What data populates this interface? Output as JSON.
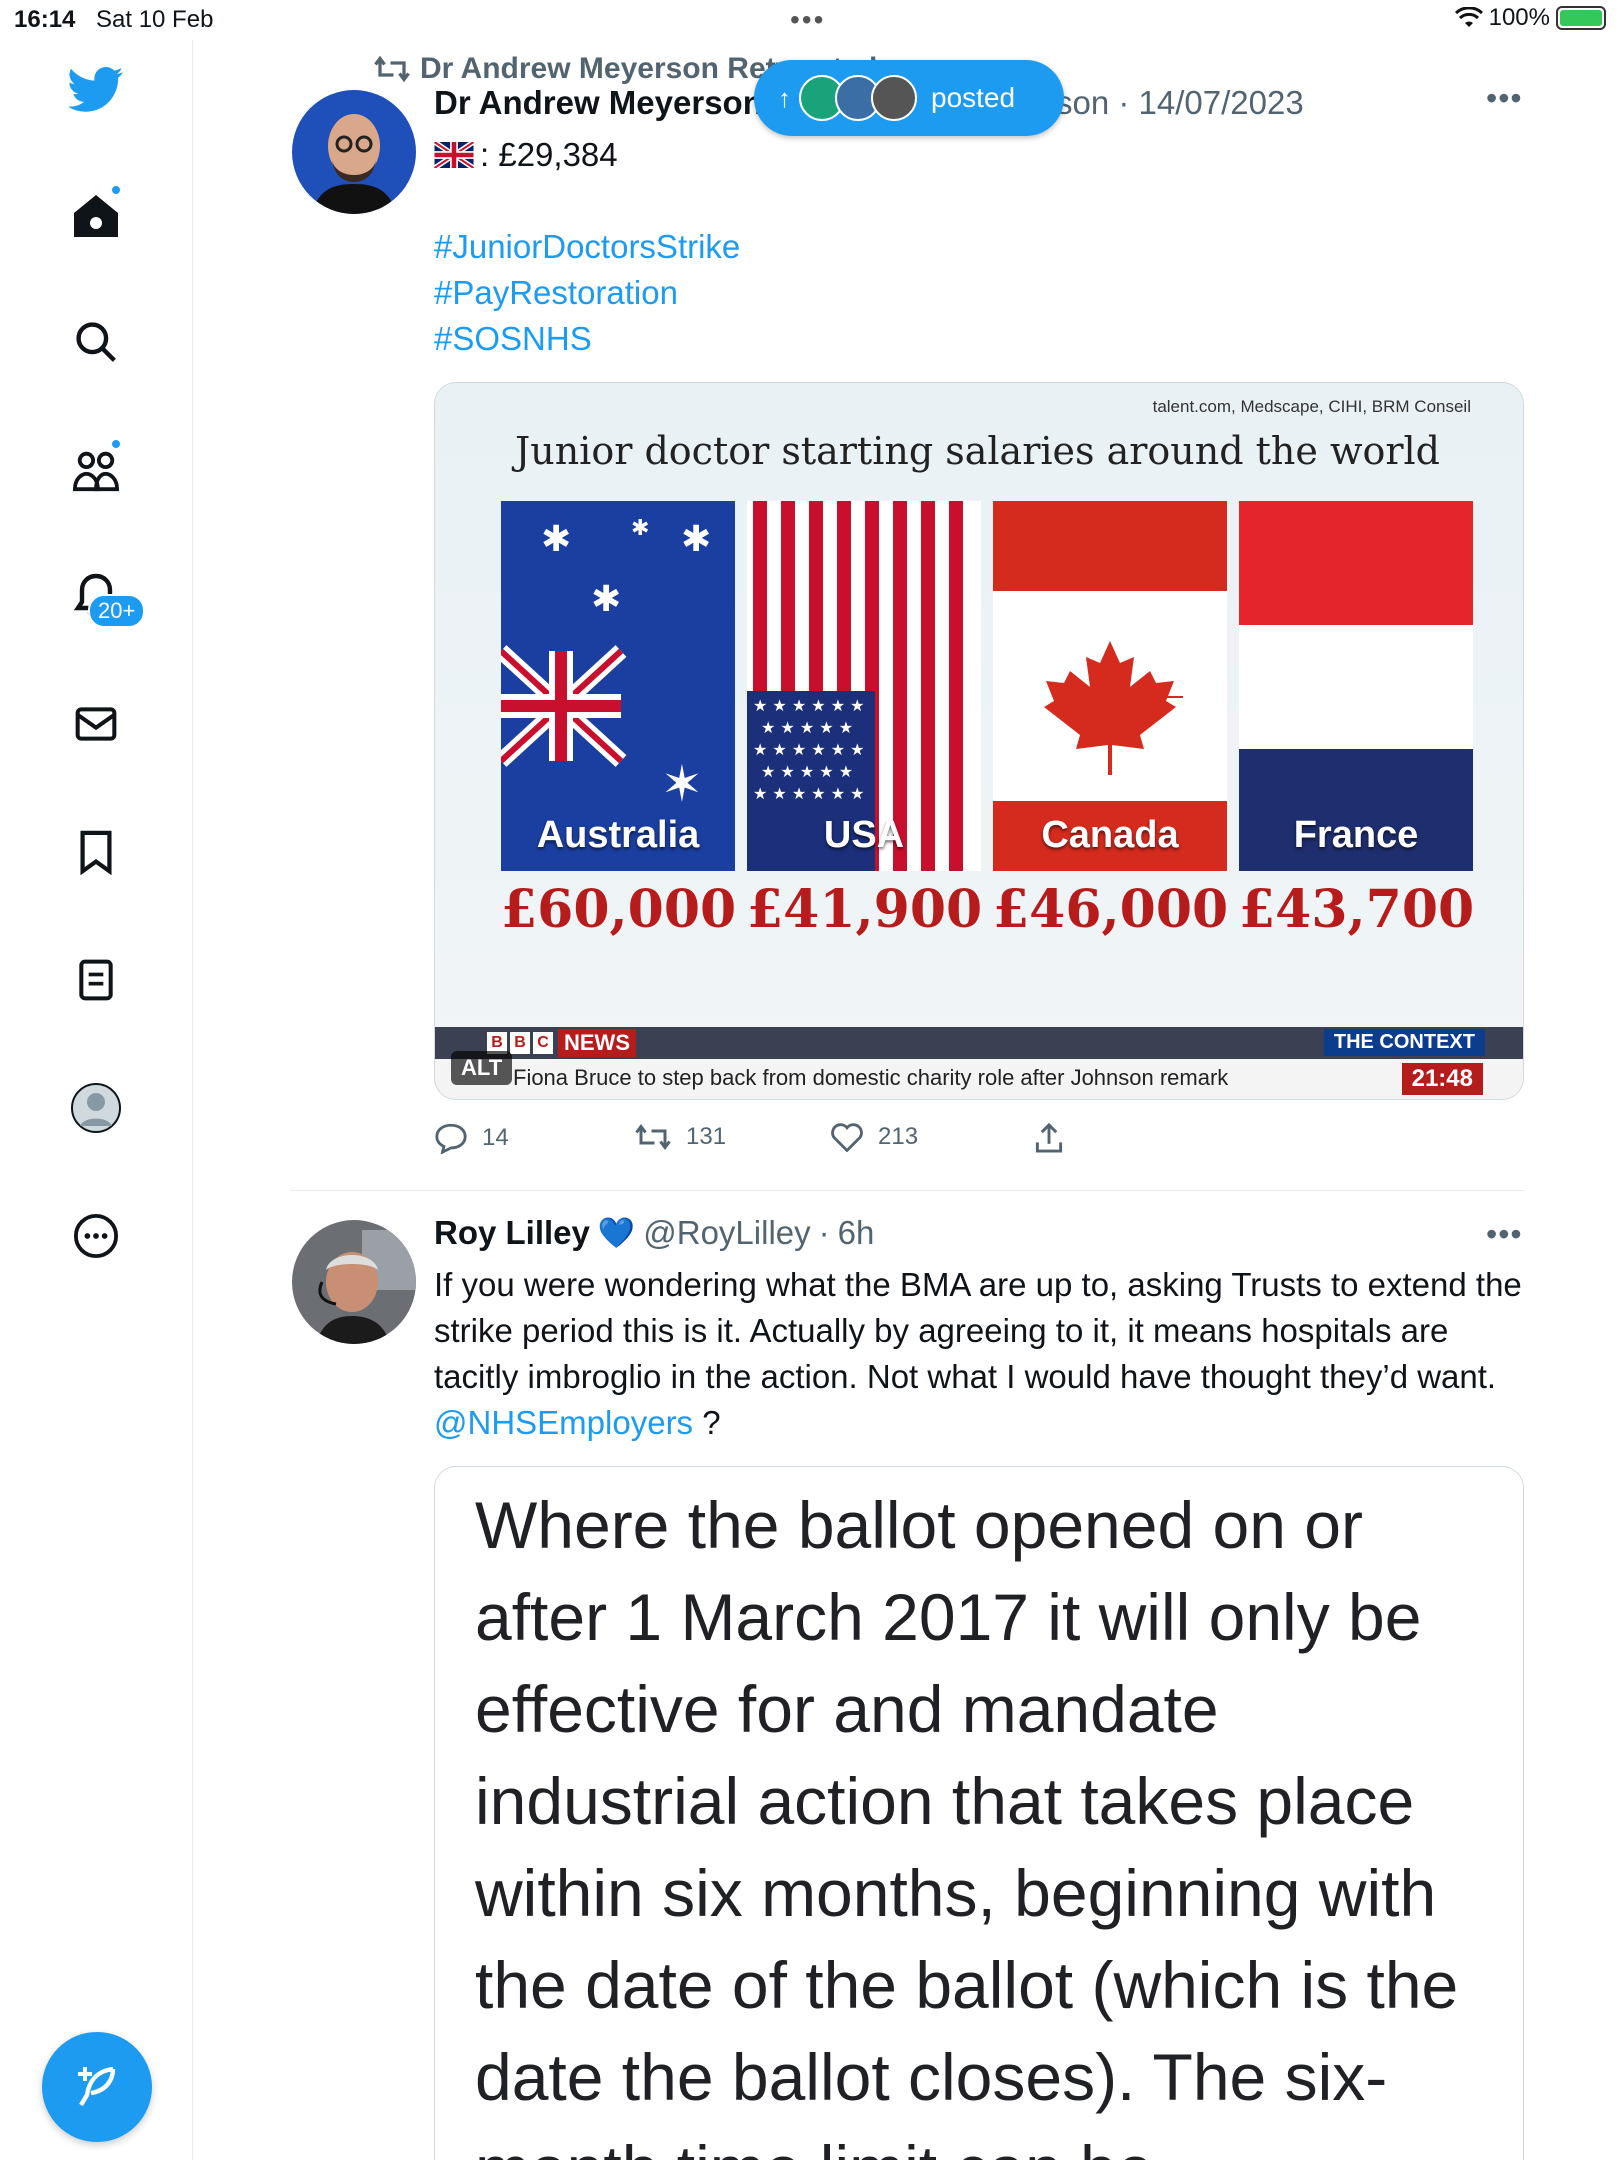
{
  "status_bar": {
    "time": "16:14",
    "date": "Sat 10 Feb",
    "battery": "100%"
  },
  "sidebar": {
    "notifications_badge": "20+"
  },
  "toast": {
    "label": "posted"
  },
  "tweet1": {
    "retweeted_by": "Dr Andrew Meyerson Retweeted",
    "author_name": "Dr Andrew Meyerson",
    "handle_fragment": "son",
    "date": "14/07/2023",
    "bio_line": ": £29,384",
    "hashtags": [
      "#JuniorDoctorsStrike",
      "#PayRestoration",
      "#SOSNHS"
    ],
    "image": {
      "source": "talent.com, Medscape, CIHI, BRM Conseil",
      "title": "Junior doctor starting salaries around the world",
      "countries": [
        {
          "name": "Australia",
          "salary": "£60,000"
        },
        {
          "name": "USA",
          "salary": "£41,900"
        },
        {
          "name": "Canada",
          "salary": "£46,000"
        },
        {
          "name": "France",
          "salary": "£43,700"
        }
      ],
      "bbc": [
        "B",
        "B",
        "C"
      ],
      "bbc_news": "NEWS",
      "context": "THE CONTEXT",
      "ticker": "Fiona Bruce to step back from domestic charity role after Johnson remark",
      "clock": "21:48",
      "alt_badge": "ALT"
    },
    "stats": {
      "replies": "14",
      "retweets": "131",
      "likes": "213"
    }
  },
  "tweet2": {
    "author_name": "Roy Lilley",
    "heart": "💙",
    "handle": "@RoyLilley",
    "age": "6h",
    "text_main": "If you were wondering  what the BMA are up to, asking Trusts to extend the strike period this is it. Actually by agreeing to it, it means hospitals are tacitly imbroglio in the action. Not what I would have thought they’d want. ",
    "mention": "@NHSEmployers",
    "text_end": " ?",
    "quote": "Where the ballot opened on or after 1 March 2017 it will only be effective for and mandate industrial action that takes place within six months, beginning with the date of the ballot (which is the date the ballot closes). The six-month time limit can be"
  },
  "colors": {
    "accent": "#1d9bf0",
    "text": "#0f1419",
    "muted": "#536471",
    "salary": "#b71c1c"
  }
}
